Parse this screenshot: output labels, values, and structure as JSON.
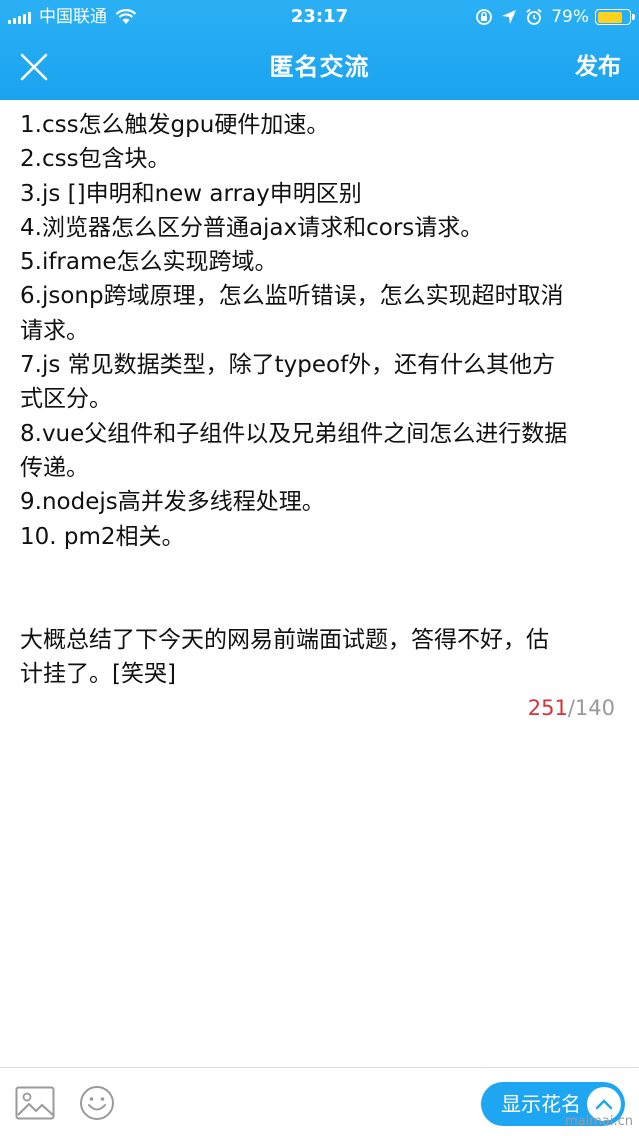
{
  "status_bar": {
    "carrier": "中国联通",
    "time": "23:17",
    "battery_percent": "79%",
    "battery_level": 0.79
  },
  "navbar": {
    "title": "匿名交流",
    "publish_label": "发布"
  },
  "content": {
    "lines": [
      "1.css怎么触发gpu硬件加速。",
      "2.css包含块。",
      "3.js []申明和new array申明区别",
      "4.浏览器怎么区分普通ajax请求和cors请求。",
      "5.iframe怎么实现跨域。",
      "6.jsonp跨域原理，怎么监听错误，怎么实现超时取消",
      "请求。",
      "7.js 常见数据类型，除了typeof外，还有什么其他方",
      "式区分。",
      "8.vue父组件和子组件以及兄弟组件之间怎么进行数据",
      "传递。",
      "9.nodejs高并发多线程处理。",
      "10. pm2相关。"
    ],
    "summary_lines": [
      "大概总结了下今天的网易前端面试题，答得不好，估",
      "计挂了。[笑哭]"
    ]
  },
  "counter": {
    "current": "251",
    "separator": "/",
    "max": "140"
  },
  "bottom_bar": {
    "image_icon": "image-icon",
    "emoji_icon": "smiley-icon",
    "show_name_label": "显示花名"
  },
  "watermark": "maimai.cn",
  "colors": {
    "header": "#1aa3ef",
    "accent": "#1ea6f2",
    "counter_over": "#d0353a",
    "battery": "#ffd21f"
  }
}
